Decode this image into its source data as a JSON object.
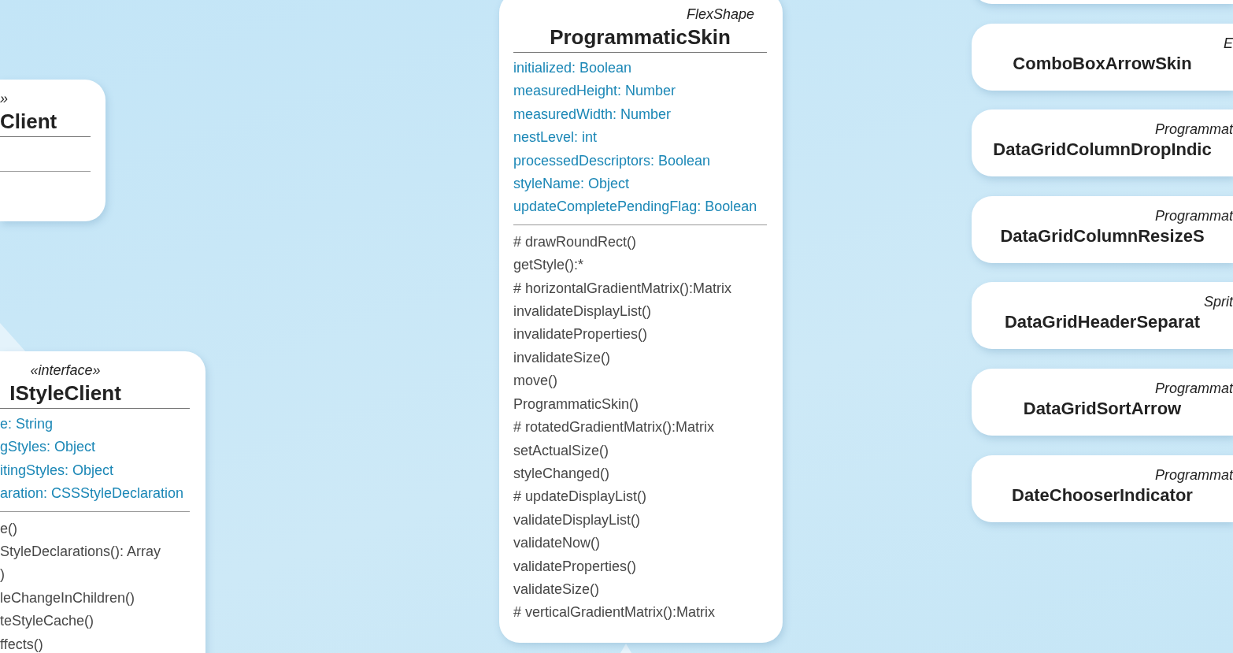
{
  "classes": [
    {
      "kind": "detailed",
      "stereotype": "»",
      "name": "Client"
    },
    {
      "kind": "detailed",
      "stereotype": "«interface»",
      "name": "IStyleClient",
      "attributes": [
        "e: String",
        "gStyles: Object",
        "itingStyles: Object",
        "aration: CSSStyleDeclaration"
      ],
      "methods": [
        "e()",
        "StyleDeclarations(): Array",
        ")",
        "leChangeInChildren()",
        "teStyleCache()",
        "ffects()"
      ]
    },
    {
      "kind": "detailed",
      "stereotype": "FlexShape",
      "name": "ProgrammaticSkin",
      "attributes": [
        "initialized: Boolean",
        "measuredHeight: Number",
        "measuredWidth: Number",
        "nestLevel: int",
        "processedDescriptors: Boolean",
        "styleName: Object",
        "updateCompletePendingFlag: Boolean"
      ],
      "methods": [
        "# drawRoundRect()",
        "getStyle():*",
        "# horizontalGradientMatrix():Matrix",
        "invalidateDisplayList()",
        "invalidateProperties()",
        "invalidateSize()",
        "move()",
        "ProgrammaticSkin()",
        "# rotatedGradientMatrix():Matrix",
        "setActualSize()",
        "styleChanged()",
        "# updateDisplayList()",
        "validateDisplayList()",
        "validateNow()",
        "validateProperties()",
        "validateSize()",
        "# verticalGradientMatrix():Matrix"
      ]
    },
    {
      "kind": "compact",
      "stereotype": "E",
      "name": "ComboBoxArrowSkin"
    },
    {
      "kind": "compact",
      "stereotype": "Programmat",
      "name": "DataGridColumnDropIndic"
    },
    {
      "kind": "compact",
      "stereotype": "Programmat",
      "name": "DataGridColumnResizeS"
    },
    {
      "kind": "compact",
      "stereotype": "Sprit",
      "name": "DataGridHeaderSeparat"
    },
    {
      "kind": "compact",
      "stereotype": "Programmat",
      "name": "DataGridSortArrow"
    },
    {
      "kind": "compact",
      "stereotype": "Programmat",
      "name": "DateChooserIndicator"
    }
  ]
}
